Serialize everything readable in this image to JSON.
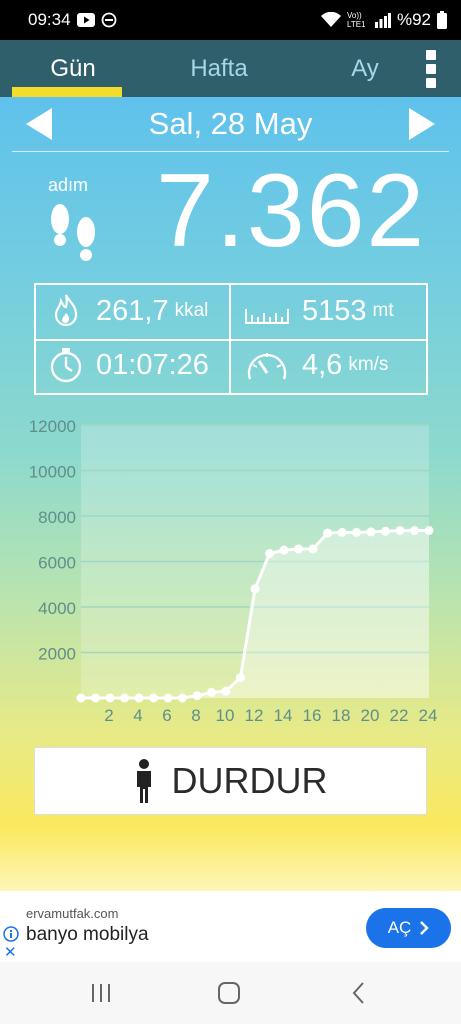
{
  "status_bar": {
    "time": "09:34",
    "network": "Vo)) LTE1",
    "battery": "%92",
    "icons": [
      "youtube-icon",
      "dnd-icon",
      "wifi-icon",
      "signal-icon",
      "battery-icon"
    ]
  },
  "tabs": [
    {
      "label": "Gün",
      "active": true
    },
    {
      "label": "Hafta",
      "active": false
    },
    {
      "label": "Ay",
      "active": false
    }
  ],
  "date": "Sal, 28 May",
  "steps": {
    "label": "adım",
    "value": "7.362"
  },
  "stats": {
    "calories": {
      "value": "261,7",
      "unit": "kkal",
      "icon": "flame-icon"
    },
    "distance": {
      "value": "5153",
      "unit": "mt",
      "icon": "ruler-icon"
    },
    "duration": {
      "value": "01:07:26",
      "icon": "stopwatch-icon"
    },
    "speed": {
      "value": "4,6",
      "unit": "km/s",
      "icon": "speedometer-icon"
    }
  },
  "chart_data": {
    "type": "line",
    "x": [
      0,
      1,
      2,
      3,
      4,
      5,
      6,
      7,
      8,
      9,
      10,
      11,
      12,
      13,
      14,
      15,
      16,
      17,
      18,
      19,
      20,
      21,
      22,
      23,
      24
    ],
    "values": [
      0,
      0,
      0,
      0,
      0,
      0,
      0,
      0,
      100,
      250,
      300,
      900,
      4800,
      6350,
      6500,
      6550,
      6550,
      7250,
      7280,
      7280,
      7300,
      7330,
      7360,
      7362,
      7362
    ],
    "xticks": [
      "2",
      "4",
      "6",
      "8",
      "10",
      "12",
      "14",
      "16",
      "18",
      "20",
      "22",
      "24"
    ],
    "yticks": [
      "2000",
      "4000",
      "6000",
      "8000",
      "10000",
      "12000"
    ],
    "ylim": [
      0,
      12000
    ],
    "xlim": [
      0,
      24
    ],
    "grid": true,
    "colors": {
      "line": "#ffffff",
      "fill": "rgba(255,255,255,0.35)",
      "grid": "#9fd7c4",
      "ticks": "#5f8f8a"
    }
  },
  "stop_button": {
    "label": "DURDUR",
    "icon": "person-icon"
  },
  "ad": {
    "domain": "ervamutfak.com",
    "title": "banyo mobilya",
    "button": "AÇ"
  },
  "colors": {
    "tabbar": "#2f5f6b",
    "tab_indicator": "#f4dc2a",
    "ad_button": "#1a73e8"
  }
}
